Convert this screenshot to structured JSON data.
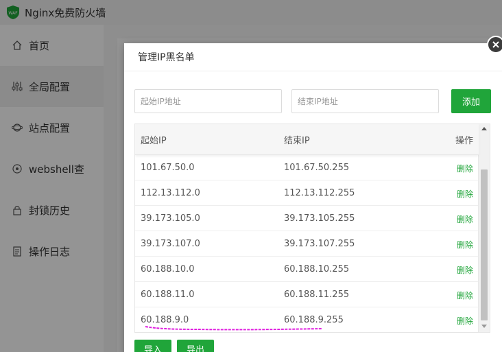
{
  "app": {
    "title": "Nginx免费防火墙"
  },
  "sidebar": {
    "items": [
      {
        "label": "首页",
        "icon": "home-icon"
      },
      {
        "label": "全局配置",
        "icon": "sliders-icon"
      },
      {
        "label": "站点配置",
        "icon": "planet-icon"
      },
      {
        "label": "webshell查",
        "icon": "target-icon"
      },
      {
        "label": "封锁历史",
        "icon": "lock-icon"
      },
      {
        "label": "操作日志",
        "icon": "clipboard-icon"
      }
    ]
  },
  "modal": {
    "title": "管理IP黑名单",
    "start_ip_placeholder": "起始IP地址",
    "end_ip_placeholder": "结束IP地址",
    "add_label": "添加",
    "columns": {
      "start": "起始IP",
      "end": "结束IP",
      "op": "操作"
    },
    "rows": [
      {
        "start": "101.67.50.0",
        "end": "101.67.50.255",
        "action": "删除"
      },
      {
        "start": "112.13.112.0",
        "end": "112.13.112.255",
        "action": "删除"
      },
      {
        "start": "39.173.105.0",
        "end": "39.173.105.255",
        "action": "删除"
      },
      {
        "start": "39.173.107.0",
        "end": "39.173.107.255",
        "action": "删除"
      },
      {
        "start": "60.188.10.0",
        "end": "60.188.10.255",
        "action": "删除"
      },
      {
        "start": "60.188.11.0",
        "end": "60.188.11.255",
        "action": "删除"
      },
      {
        "start": "60.188.9.0",
        "end": "60.188.9.255",
        "action": "删除"
      }
    ],
    "import_label": "导入",
    "export_label": "导出"
  },
  "colors": {
    "accent": "#20a53a",
    "highlight": "#e020e0"
  }
}
